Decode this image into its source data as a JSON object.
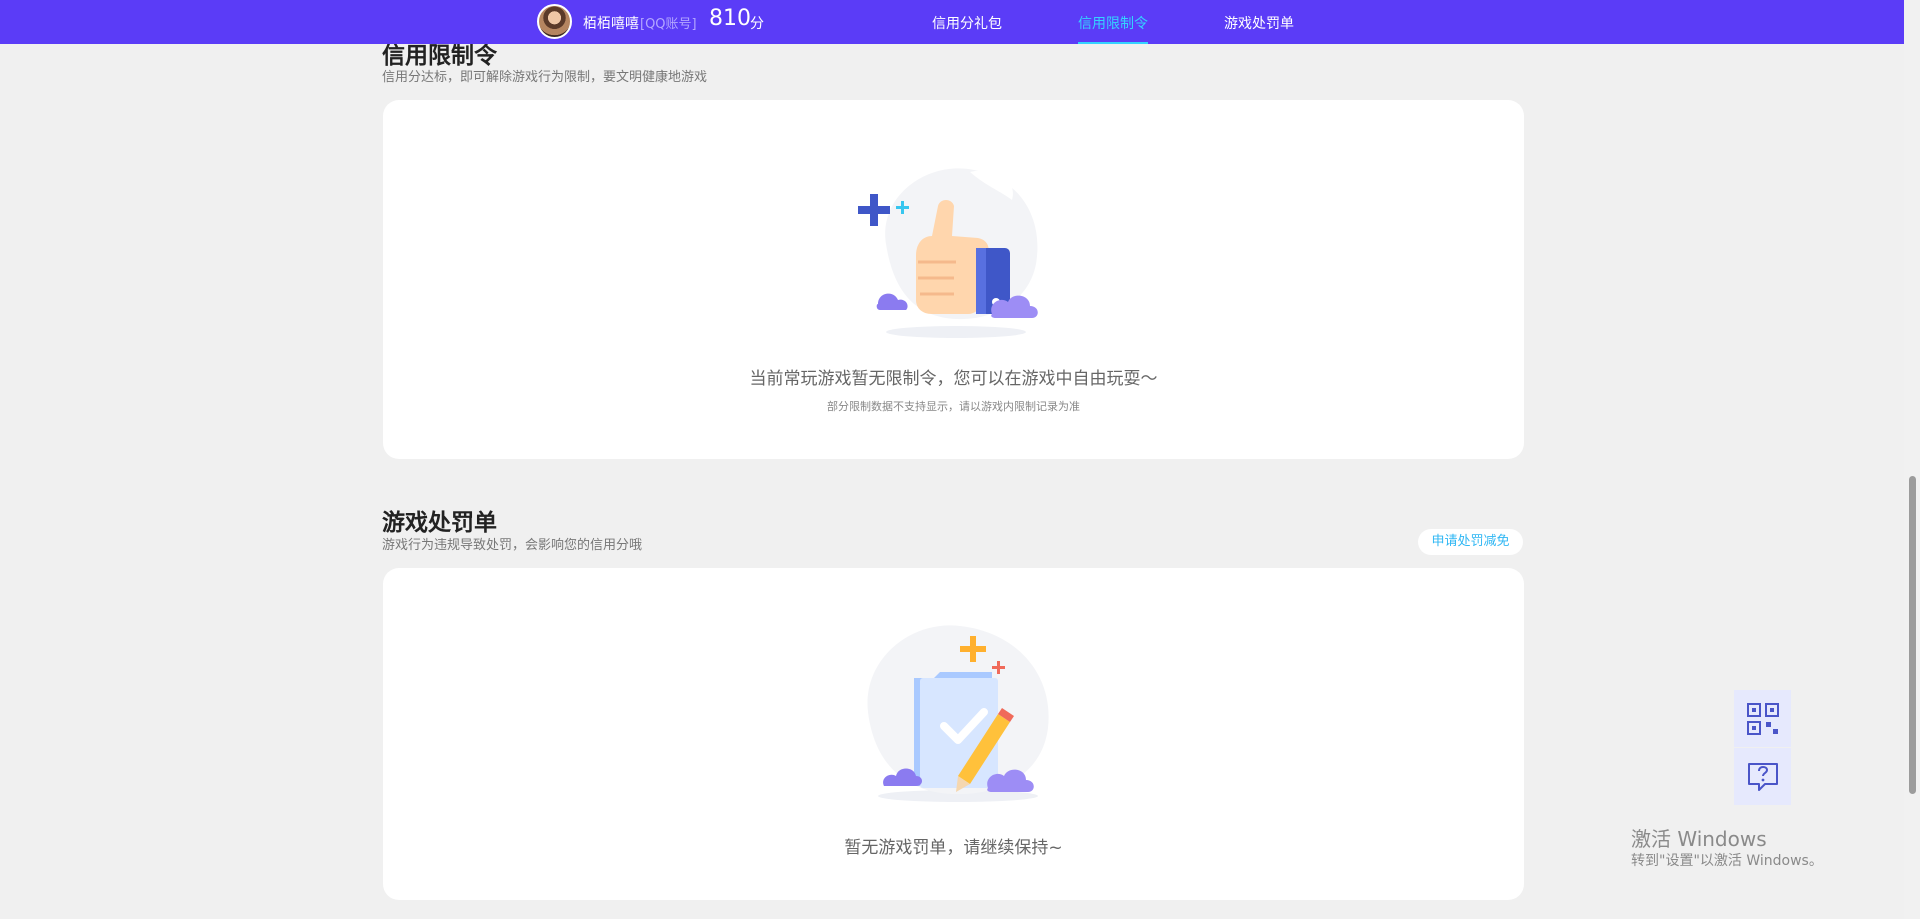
{
  "header": {
    "user_name": "栢栢嘻嘻",
    "account_type": "[QQ账号]",
    "credit_score": "810",
    "score_unit": "分",
    "tabs": [
      {
        "label": "信用分礼包"
      },
      {
        "label": "信用限制令"
      },
      {
        "label": "游戏处罚单"
      }
    ]
  },
  "restriction": {
    "title": "信用限制令",
    "subtitle": "信用分达标，即可解除游戏行为限制，要文明健康地游戏",
    "message": "当前常玩游戏暂无限制令，您可以在游戏中自由玩耍～",
    "note": "部分限制数据不支持显示，请以游戏内限制记录为准"
  },
  "penalty": {
    "title": "游戏处罚单",
    "subtitle": "游戏行为违规导致处罚，会影响您的信用分哦",
    "appeal_label": "申请处罚减免",
    "message": "暂无游戏罚单，请继续保持~"
  },
  "windows": {
    "title": "激活 Windows",
    "subtitle": "转到\"设置\"以激活 Windows。"
  },
  "colors": {
    "brand": "#5b3cf7",
    "active_tab": "#34d3ff",
    "link": "#2fb7f4"
  }
}
